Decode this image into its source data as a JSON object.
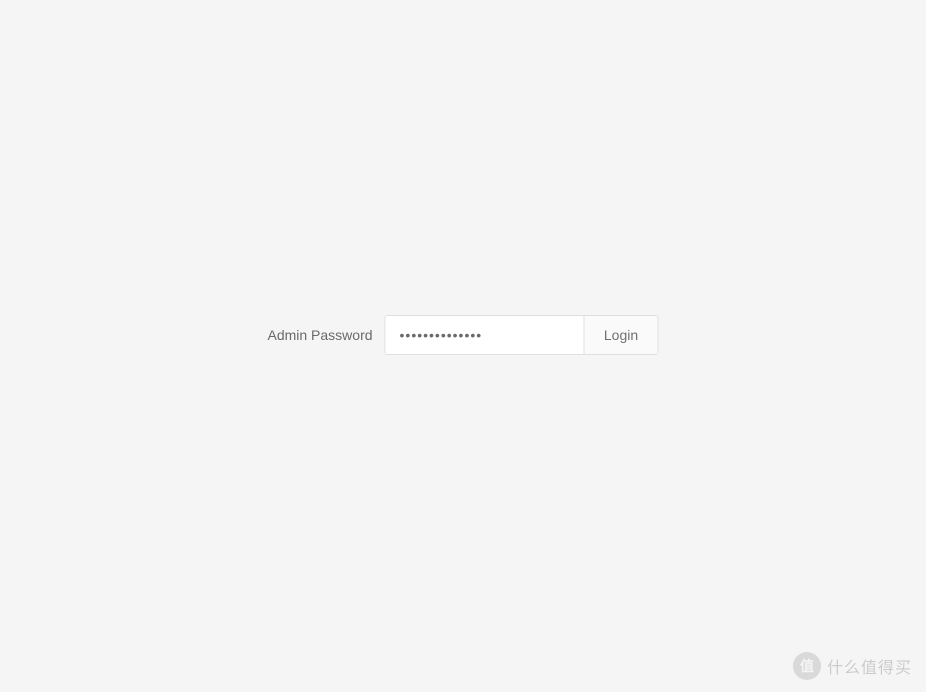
{
  "login": {
    "label": "Admin Password",
    "password_value": "••••••••••••••",
    "button_label": "Login"
  },
  "watermark": {
    "icon_text": "值",
    "text": "什么值得买"
  }
}
